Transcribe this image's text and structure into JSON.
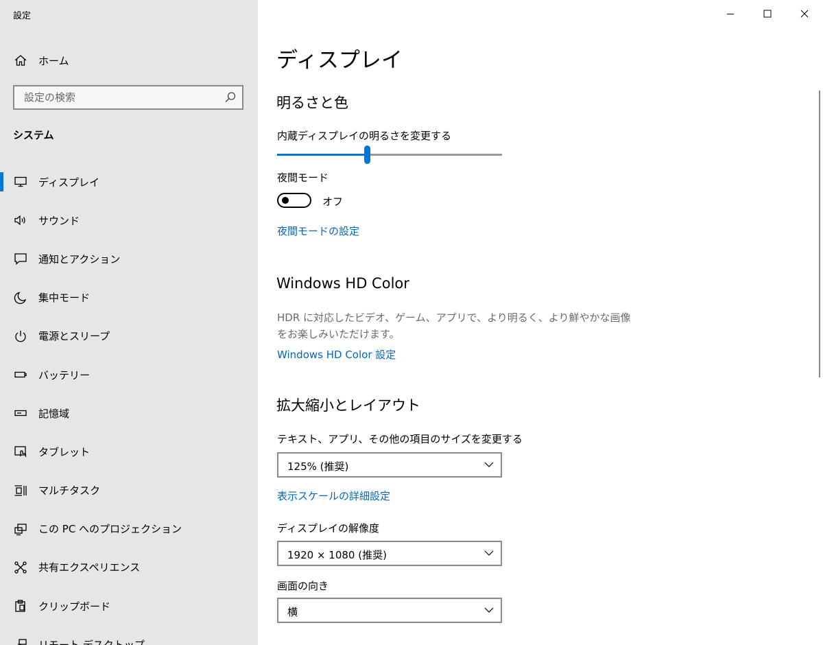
{
  "window": {
    "title": "設定",
    "controls": {
      "minimize": "minimize-icon",
      "maximize": "maximize-icon",
      "close": "close-icon"
    }
  },
  "sidebar": {
    "home_label": "ホーム",
    "search_placeholder": "設定の検索",
    "section_heading": "システム",
    "selected_index": 0,
    "items": [
      {
        "label": "ディスプレイ",
        "icon": "monitor-icon"
      },
      {
        "label": "サウンド",
        "icon": "speaker-icon"
      },
      {
        "label": "通知とアクション",
        "icon": "notification-icon"
      },
      {
        "label": "集中モード",
        "icon": "moon-icon"
      },
      {
        "label": "電源とスリープ",
        "icon": "power-icon"
      },
      {
        "label": "バッテリー",
        "icon": "battery-icon"
      },
      {
        "label": "記憶域",
        "icon": "storage-icon"
      },
      {
        "label": "タブレット",
        "icon": "tablet-icon"
      },
      {
        "label": "マルチタスク",
        "icon": "multitask-icon"
      },
      {
        "label": "この PC へのプロジェクション",
        "icon": "projection-icon"
      },
      {
        "label": "共有エクスペリエンス",
        "icon": "shared-experience-icon"
      },
      {
        "label": "クリップボード",
        "icon": "clipboard-icon"
      },
      {
        "label": "リモート デスクトップ",
        "icon": "remote-desktop-icon"
      }
    ]
  },
  "content": {
    "page_title": "ディスプレイ",
    "brightness": {
      "heading": "明るさと色",
      "slider_label": "内蔵ディスプレイの明るさを変更する",
      "slider_level": 0.4,
      "night_light_label": "夜間モード",
      "night_light_state": "オフ",
      "night_light_on": false,
      "night_light_settings_link": "夜間モードの設定"
    },
    "hd_color": {
      "heading": "Windows HD Color",
      "description": "HDR に対応したビデオ、ゲーム、アプリで、より明るく、より鮮やかな画像をお楽しみいただけます。",
      "settings_link": "Windows HD Color 設定"
    },
    "scale_layout": {
      "heading": "拡大縮小とレイアウト",
      "scale_label": "テキスト、アプリ、その他の項目のサイズを変更する",
      "scale_value": "125% (推奨)",
      "advanced_scale_link": "表示スケールの詳細設定",
      "resolution_label": "ディスプレイの解像度",
      "resolution_value": "1920 × 1080 (推奨)",
      "orientation_label": "画面の向き",
      "orientation_value": "横"
    }
  },
  "colors": {
    "accent": "#0078d7",
    "link": "#0067c0",
    "sidebar_bg": "#e6e6e6"
  }
}
